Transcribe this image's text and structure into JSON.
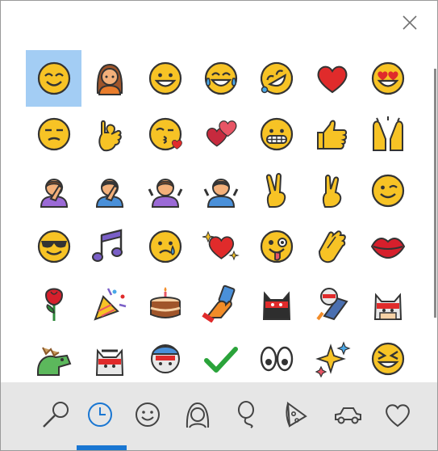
{
  "picker": {
    "close_icon": "close-icon",
    "accent_color": "#1976d2",
    "selected_bg": "#a3cdf4",
    "emojis": [
      {
        "name": "smiling-face-icon"
      },
      {
        "name": "woman-icon"
      },
      {
        "name": "grinning-face-icon"
      },
      {
        "name": "tears-of-joy-face-icon"
      },
      {
        "name": "rolling-laughing-face-icon"
      },
      {
        "name": "red-heart-icon"
      },
      {
        "name": "heart-eyes-face-icon"
      },
      {
        "name": "unamused-face-icon"
      },
      {
        "name": "ok-hand-icon"
      },
      {
        "name": "kissing-face-icon"
      },
      {
        "name": "two-hearts-icon"
      },
      {
        "name": "grimacing-face-icon"
      },
      {
        "name": "thumbs-up-icon"
      },
      {
        "name": "raising-hands-icon"
      },
      {
        "name": "woman-facepalm-icon"
      },
      {
        "name": "man-facepalm-icon"
      },
      {
        "name": "woman-shrugging-icon"
      },
      {
        "name": "man-shrugging-icon"
      },
      {
        "name": "victory-hand-icon"
      },
      {
        "name": "crossed-fingers-icon"
      },
      {
        "name": "winking-face-icon"
      },
      {
        "name": "sunglasses-face-icon"
      },
      {
        "name": "musical-notes-icon"
      },
      {
        "name": "crying-face-icon"
      },
      {
        "name": "sparkling-heart-icon"
      },
      {
        "name": "zany-face-icon"
      },
      {
        "name": "clapping-hands-icon"
      },
      {
        "name": "kiss-lips-icon"
      },
      {
        "name": "rose-icon"
      },
      {
        "name": "party-popper-icon"
      },
      {
        "name": "birthday-cake-icon"
      },
      {
        "name": "selfie-icon"
      },
      {
        "name": "ninja-cat-icon"
      },
      {
        "name": "astro-cat-icon"
      },
      {
        "name": "hipster-cat-icon"
      },
      {
        "name": "dino-cat-icon"
      },
      {
        "name": "hacker-cat-icon"
      },
      {
        "name": "stunt-cat-icon"
      },
      {
        "name": "check-mark-icon"
      },
      {
        "name": "eyes-icon"
      },
      {
        "name": "sparkles-icon"
      },
      {
        "name": "squinting-face-icon"
      }
    ],
    "tabs": [
      {
        "name": "search-icon"
      },
      {
        "name": "recently-used-clock-icon",
        "selected": true
      },
      {
        "name": "smiley-icon"
      },
      {
        "name": "people-icon"
      },
      {
        "name": "balloon-icon"
      },
      {
        "name": "pizza-icon"
      },
      {
        "name": "car-icon"
      },
      {
        "name": "heart-outline-icon"
      }
    ]
  }
}
